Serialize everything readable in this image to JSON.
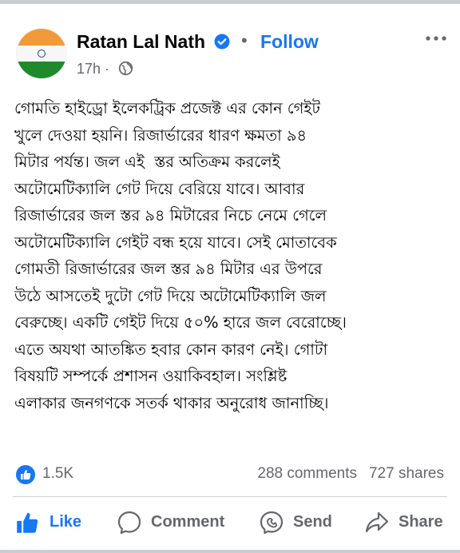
{
  "post": {
    "author": "Ratan Lal Nath",
    "follow_label": "Follow",
    "time": "17h ·",
    "separator": "•",
    "text": "গোমতি হাইড্রো ইলেকট্রিক প্রজেক্ট এর কোন গেইট\nখুলে দেওয়া হয়নি। রিজার্ভারের ধারণ ক্ষমতা ৯৪\nমিটার পর্যন্ত। জল এই  স্তর অতিক্রম করলেই\nঅটোমেটিক্যালি গেট দিয়ে বেরিয়ে যাবে। আবার\nরিজার্ভারের জল স্তর ৯৪ মিটারের নিচে নেমে গেলে\nঅটোমেটিক্যালি গেইট বন্ধ হয়ে যাবে। সেই মোতাবেক\nগোমতী রিজার্ভারের জল স্তর ৯৪ মিটার এর উপরে\nউঠে আসতেই দুটো গেট দিয়ে অটোমেটিক্যালি জল\nবেরুচ্ছে। একটি গেইট দিয়ে ৫০% হারে জল বেরোচ্ছে।\nএতে অযথা আতঙ্কিত হবার কোন কারণ নেই। গোটা\nবিষয়টি সম্পর্কে প্রশাসন ওয়াকিবহাল। সংশ্লিষ্ট\nএলাকার জনগণকে সতর্ক থাকার অনুরোধ জানাচ্ছি।"
  },
  "stats": {
    "likes": "1.5K",
    "comments": "288 comments",
    "shares": "727 shares"
  },
  "actions": {
    "like": "Like",
    "comment": "Comment",
    "send": "Send",
    "share": "Share"
  },
  "colors": {
    "accent": "#1877f2",
    "secondary_text": "#65676b"
  },
  "icons": [
    "verified-badge-icon",
    "more-options-icon",
    "globe-icon",
    "like-reaction-icon",
    "thumbs-up-icon",
    "comment-icon",
    "messenger-send-icon",
    "share-arrow-icon"
  ]
}
